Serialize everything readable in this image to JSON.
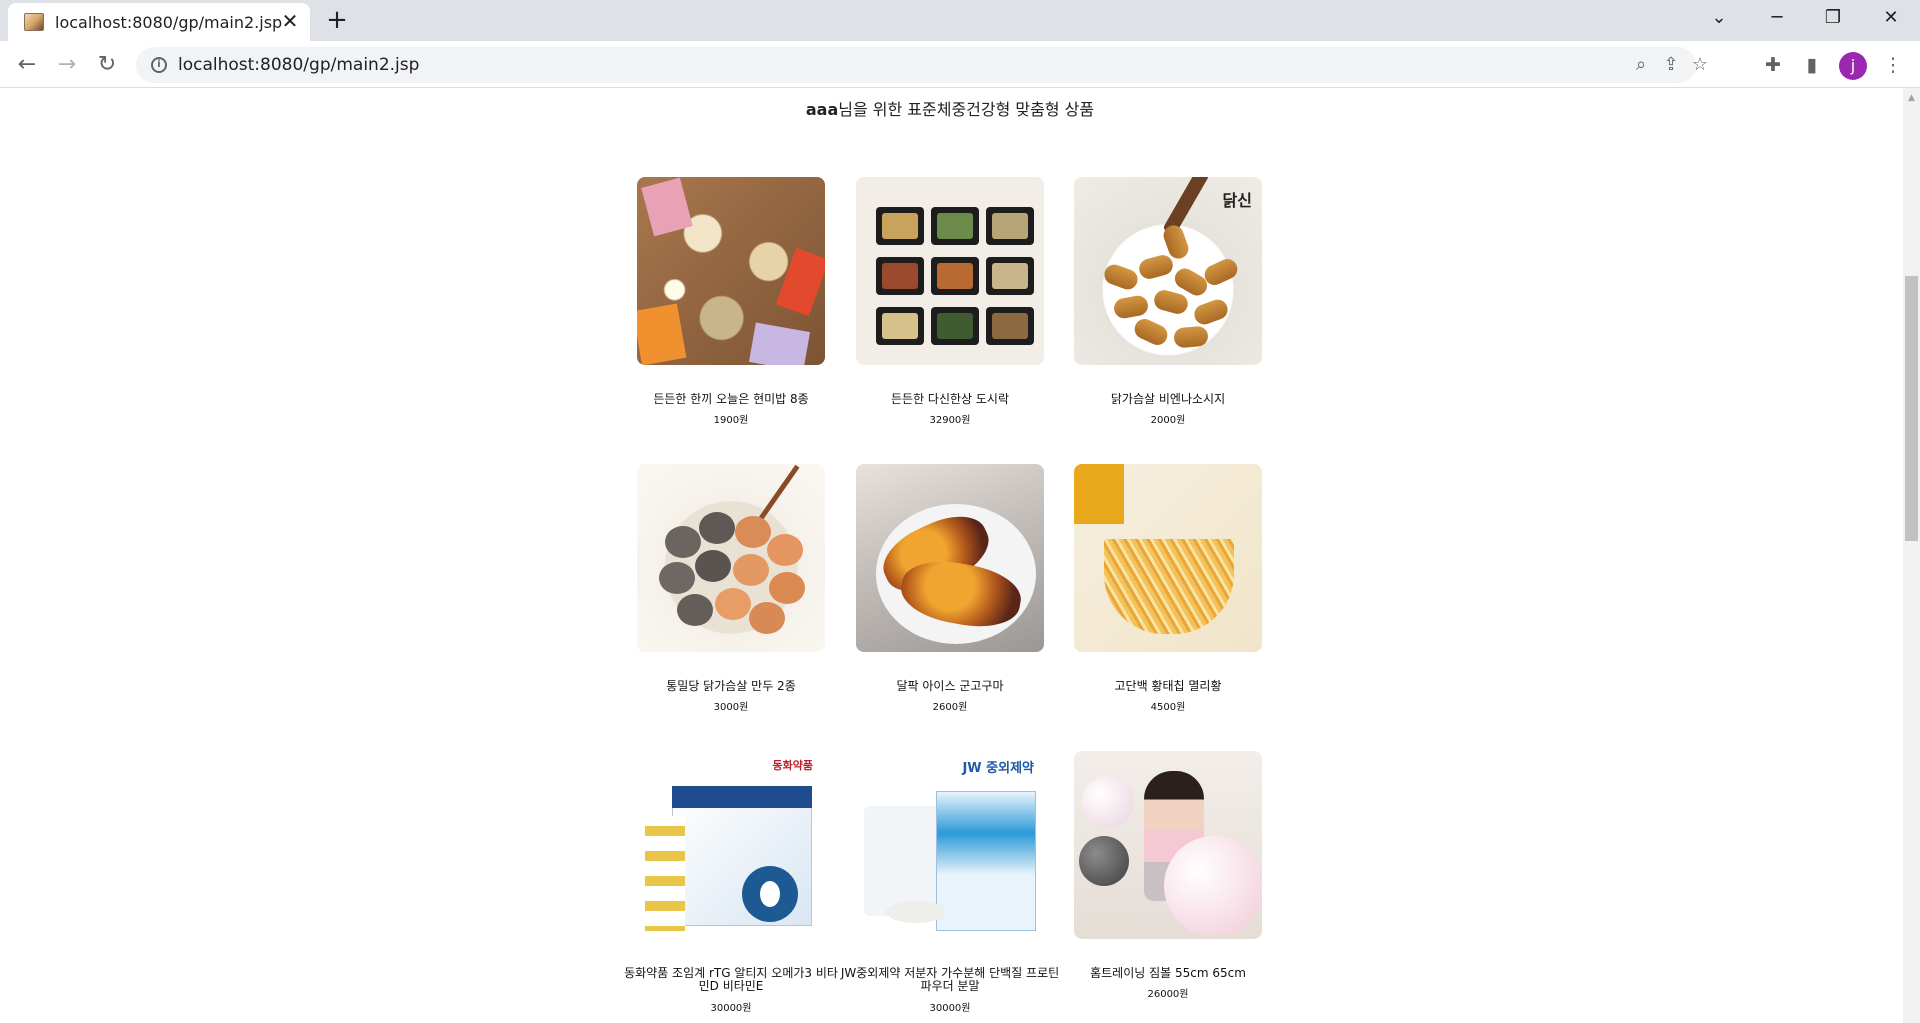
{
  "browser": {
    "tab_title": "localhost:8080/gp/main2.jsp",
    "tab_close": "✕",
    "new_tab": "+",
    "url": "localhost:8080/gp/main2.jsp",
    "profile_initial": "j"
  },
  "page": {
    "heading_user": "aaa",
    "heading_rest": "님을 위한 표준체중건강형 맞춤형 상품"
  },
  "products": [
    {
      "name": "든든한 한끼 오늘은 현미밥 8종",
      "price": "1900원"
    },
    {
      "name": "든든한 다신한상 도시락",
      "price": "32900원"
    },
    {
      "name": "닭가슴살 비엔나소시지",
      "price": "2000원"
    },
    {
      "name": "통밀당 닭가슴살 만두 2종",
      "price": "3000원"
    },
    {
      "name": "달팍 아이스 군고구마",
      "price": "2600원"
    },
    {
      "name": "고단백 황태칩 멸리황",
      "price": "4500원"
    },
    {
      "name": "동화약품 조임계 rTG 알티지 오메가3 비타민D 비타민E",
      "price": "30000원",
      "brand": "동화약품"
    },
    {
      "name": "JW중외제약 저분자 가수분해 단백질 프로틴 파우더 분말",
      "price": "30000원",
      "brand": "JW 중외제약"
    },
    {
      "name": "홈트레이닝 짐볼 55cm 65cm",
      "price": "26000원"
    }
  ],
  "image_labels": {
    "sausage_logo": "닭신"
  }
}
